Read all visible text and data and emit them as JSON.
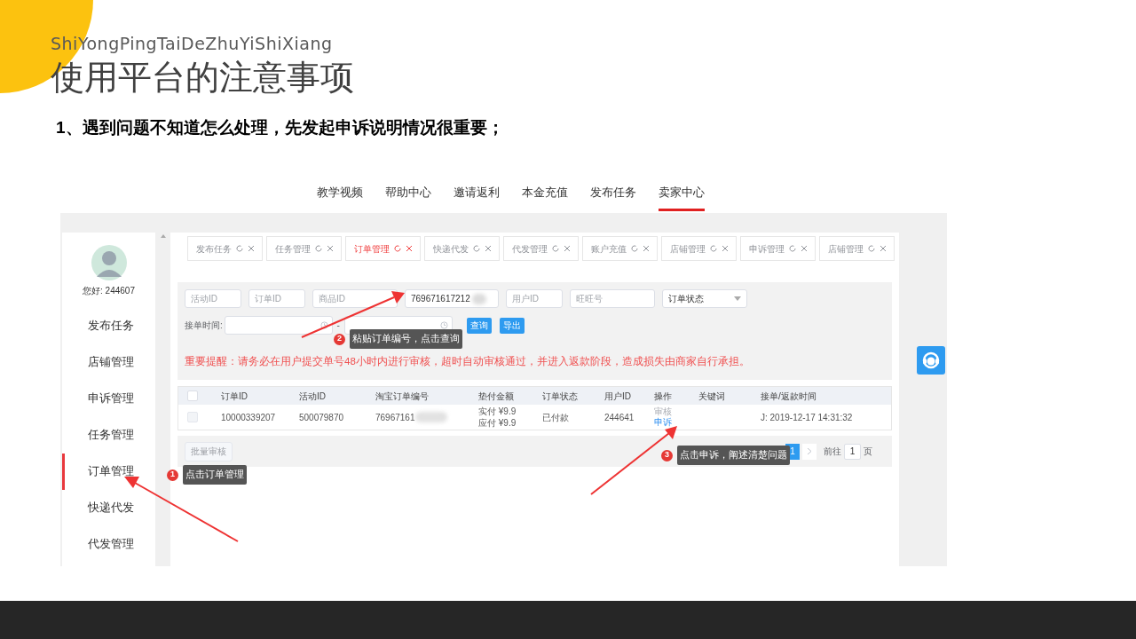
{
  "slide": {
    "pinyin_title": "ShiYongPingTaiDeZhuYiShiXiang",
    "title": "使用平台的注意事项",
    "point": "1、遇到问题不知道怎么处理，先发起申诉说明情况很重要；"
  },
  "screenshot": {
    "top_nav": [
      {
        "label": "教学视频",
        "selected": false
      },
      {
        "label": "帮助中心",
        "selected": false
      },
      {
        "label": "邀请返利",
        "selected": false
      },
      {
        "label": "本金充值",
        "selected": false
      },
      {
        "label": "发布任务",
        "selected": false
      },
      {
        "label": "卖家中心",
        "selected": true
      }
    ],
    "greeting": "您好: 244607",
    "sidebar": [
      {
        "label": "发布任务",
        "selected": false
      },
      {
        "label": "店铺管理",
        "selected": false
      },
      {
        "label": "申诉管理",
        "selected": false
      },
      {
        "label": "任务管理",
        "selected": false
      },
      {
        "label": "订单管理",
        "selected": true
      },
      {
        "label": "快递代发",
        "selected": false
      },
      {
        "label": "代发管理",
        "selected": false
      }
    ],
    "tabs": [
      {
        "label": "发布任务",
        "selected": false
      },
      {
        "label": "任务管理",
        "selected": false
      },
      {
        "label": "订单管理",
        "selected": true
      },
      {
        "label": "快递代发",
        "selected": false
      },
      {
        "label": "代发管理",
        "selected": false
      },
      {
        "label": "账户充值",
        "selected": false
      },
      {
        "label": "店铺管理",
        "selected": false
      },
      {
        "label": "申诉管理",
        "selected": false
      },
      {
        "label": "店铺管理",
        "selected": false
      }
    ],
    "filters": {
      "fields": [
        {
          "placeholder": "活动ID"
        },
        {
          "placeholder": "订单ID"
        },
        {
          "placeholder": "商品ID"
        },
        {
          "value": "769671617212"
        },
        {
          "placeholder": "用户ID"
        },
        {
          "placeholder": "旺旺号"
        }
      ],
      "status_select": "订单状态",
      "time_label": "接单时间:",
      "time_separator": "-",
      "buttons": [
        "查询",
        "导出"
      ]
    },
    "notice": "重要提醒：请务必在用户提交单号48小时内进行审核，超时自动审核通过，并进入返款阶段，造成损失由商家自行承担。",
    "table": {
      "header_checked": false,
      "columns": [
        "订单ID",
        "活动ID",
        "淘宝订单编号",
        "垫付金额",
        "订单状态",
        "用户ID",
        "操作",
        "关键词",
        "接单/返款时间"
      ],
      "rows": [
        {
          "checked": false,
          "order_id": "10000339207",
          "activity_id": "500079870",
          "taobao_no": "76967161",
          "amounts": [
            "实付 ¥9.9",
            "应付 ¥9.9"
          ],
          "status": "已付款",
          "user_id": "244641",
          "actions": [
            {
              "label": "审核",
              "disabled": true
            },
            {
              "label": "申诉",
              "disabled": false
            }
          ],
          "time": "J: 2019-12-17 14:31:32"
        }
      ]
    },
    "batch_button": "批量审核",
    "pagination": {
      "pages": [
        {
          "label": "1",
          "selected": true
        }
      ],
      "goto_label": "前往",
      "goto_value": "1",
      "unit": "页"
    }
  },
  "annotations": [
    {
      "number": "1",
      "text": "点击订单管理"
    },
    {
      "number": "2",
      "text": "粘贴订单编号，点击查询"
    },
    {
      "number": "3",
      "text": "点击申诉，阐述清楚问题"
    }
  ]
}
